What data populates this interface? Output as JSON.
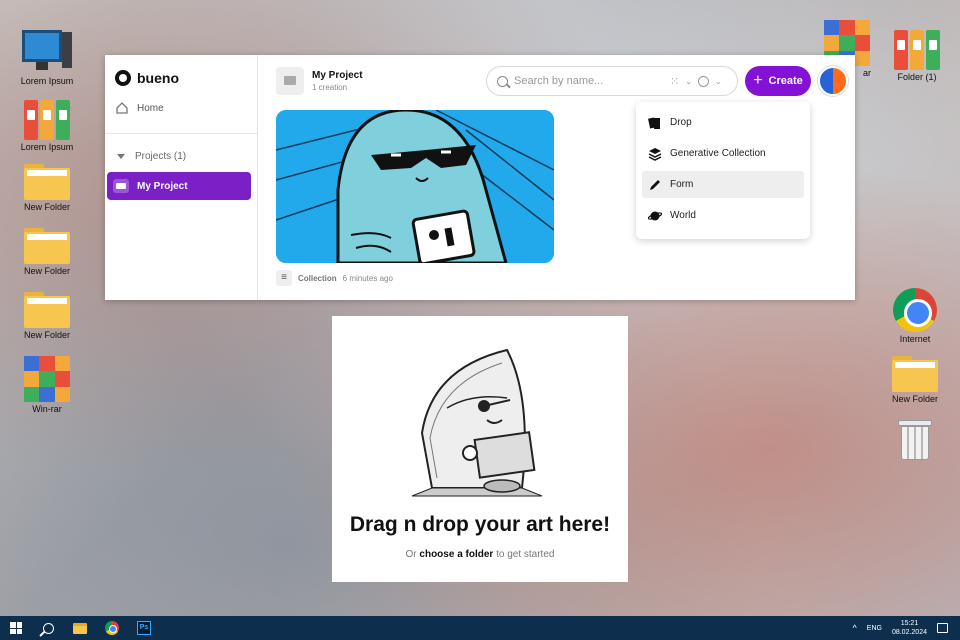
{
  "desktop": {
    "left_icons": [
      {
        "label": "Lorem Ipsum",
        "type": "monitor"
      },
      {
        "label": "Lorem Ipsum",
        "type": "binder"
      },
      {
        "label": "New Folder",
        "type": "folder"
      },
      {
        "label": "New Folder",
        "type": "folder"
      },
      {
        "label": "New Folder",
        "type": "folder"
      },
      {
        "label": "Win-rar",
        "type": "winrar"
      }
    ],
    "right_icons": {
      "winrar_partial": "ar",
      "folder1": "Folder (1)",
      "internet": "Internet",
      "new_folder": "New Folder"
    }
  },
  "app": {
    "brand": "bueno",
    "nav": {
      "home": "Home",
      "projects": "Projects (1)",
      "active_project": "My Project"
    },
    "project": {
      "title": "My Project",
      "subtitle": "1 creation"
    },
    "search": {
      "placeholder": "Search by name..."
    },
    "create_label": "Create",
    "card": {
      "type": "Collection",
      "time": "6 minutes ago"
    },
    "create_menu": [
      {
        "label": "Drop",
        "icon": "drop-icon"
      },
      {
        "label": "Generative Collection",
        "icon": "layers-icon"
      },
      {
        "label": "Form",
        "icon": "pen-icon"
      },
      {
        "label": "World",
        "icon": "planet-icon"
      }
    ]
  },
  "drop_panel": {
    "title": "Drag n drop your art here!",
    "sub_prefix": "Or",
    "sub_link": "choose a folder",
    "sub_suffix": "to get started"
  },
  "taskbar": {
    "lang": "ENG",
    "time": "15:21",
    "date": "08.02.2024",
    "ps_label": "Ps"
  },
  "colors": {
    "accent": "#8412d6",
    "sidebar_active": "#7b1fc7",
    "taskbar": "#0d2f4d"
  }
}
